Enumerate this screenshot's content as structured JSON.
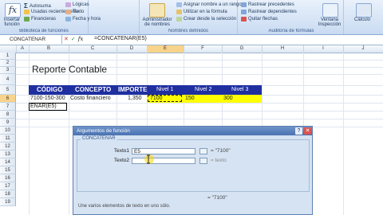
{
  "ribbon": {
    "insert_function_label": "Insertar función",
    "autosum_label": "Autosuma",
    "recent_label": "Usadas recientemente",
    "financial_label": "Financieras",
    "logical_label": "Lógicas",
    "text_label": "Texto",
    "datetime_label": "Fecha y hora",
    "group_function_library": "Biblioteca de funciones",
    "name_manager_label": "Administrador de nombres",
    "assign_name_label": "Asignar nombre a un rango",
    "use_in_formula_label": "Utilizar en la fórmula",
    "create_from_selection_label": "Crear desde la selección",
    "group_defined_names": "Nombres definidos",
    "trace_precedents_label": "Rastrear precedentes",
    "trace_dependents_label": "Rastrear dependientes",
    "remove_arrows_label": "Quitar flechas",
    "watch_window_label": "Ventana Inspección",
    "group_formula_auditing": "Auditoría de fórmulas",
    "calc_label": "Cálculo"
  },
  "formula_bar": {
    "name_box": "CONCATENAR",
    "cancel_glyph": "✕",
    "enter_glyph": "✓",
    "fx_glyph": "fx",
    "formula": "=CONCATENAR(E5)"
  },
  "columns": [
    "A",
    "B",
    "C",
    "D",
    "E",
    "F",
    "G",
    "H",
    "I",
    "J"
  ],
  "rows": [
    "1",
    "2",
    "3",
    "4",
    "5",
    "6",
    "7",
    "8",
    "9",
    "10",
    "11",
    "12",
    "13",
    "14",
    "15",
    "16",
    "17",
    "18",
    "19"
  ],
  "sheet": {
    "title": "Reporte Contable",
    "headers": [
      "CÓDIGO",
      "CONCEPTO",
      "IMPORTE",
      "Nivel 1",
      "Nivel 2",
      "Nivel 3"
    ],
    "row5": [
      "7100-150-300",
      "Costo financiero",
      "1,350",
      "7100",
      "150",
      "300"
    ],
    "editing_cell": "ENAR(E5)"
  },
  "dialog": {
    "title": "Argumentos de función",
    "function_name": "CONCATENAR",
    "help_glyph": "?",
    "close_glyph": "✕",
    "arg1_label": "Texto1",
    "arg1_value": "E5",
    "arg1_result": "= \"7100\"",
    "arg2_label": "Texto2",
    "arg2_value": "",
    "arg2_result": "= texto",
    "total_result": "= \"7100\"",
    "description": "Une varios elementos de texto en uno sólo."
  },
  "colors": {
    "header_fill": "#1f2fa0",
    "level_fill": "#ffff00",
    "ribbon_bg": "#c9dbf2"
  }
}
